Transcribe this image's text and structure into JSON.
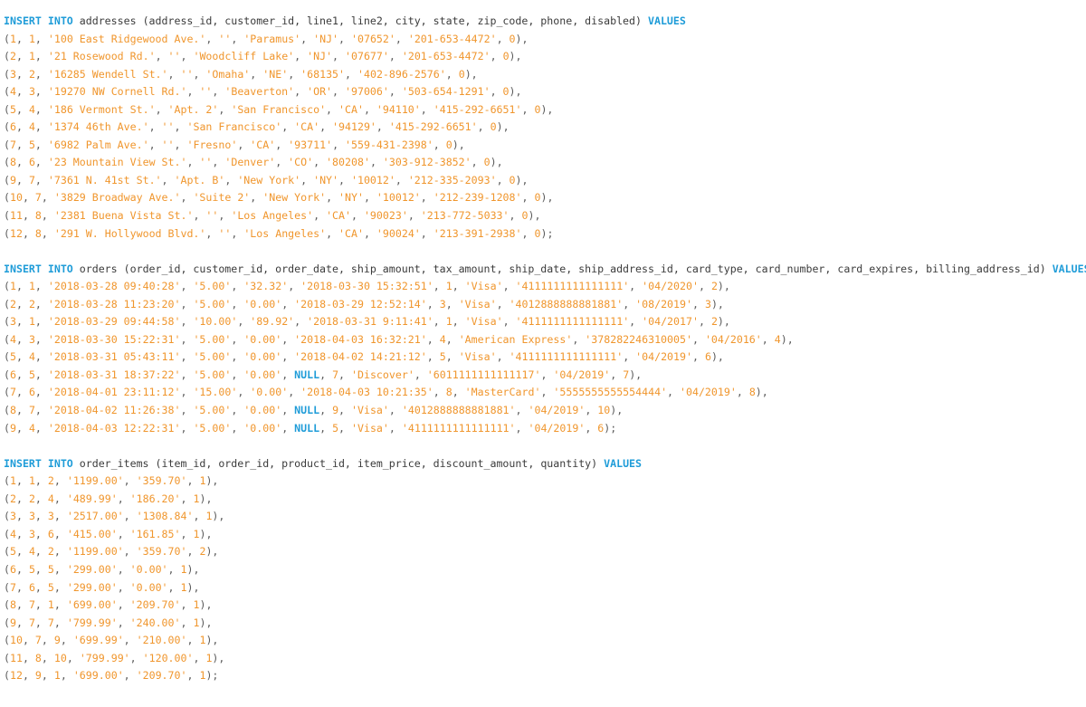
{
  "editor": {
    "language": "sql",
    "theme": {
      "background": "#ffffff",
      "keyword_color": "#1f9cd8",
      "identifier_color": "#3b3b3b",
      "string_color": "#f0962d",
      "number_color": "#f0962d",
      "punctuation_color": "#5b5b5b"
    }
  },
  "statements": [
    {
      "name": "insert-addresses",
      "keyword": "INSERT INTO",
      "table": "addresses",
      "columns": "(address_id, customer_id, line1, line2, city, state, zip_code, phone, disabled)",
      "values_keyword": "VALUES",
      "rows": [
        "(1, 1, '100 East Ridgewood Ave.', '', 'Paramus', 'NJ', '07652', '201-653-4472', 0),",
        "(2, 1, '21 Rosewood Rd.', '', 'Woodcliff Lake', 'NJ', '07677', '201-653-4472', 0),",
        "(3, 2, '16285 Wendell St.', '', 'Omaha', 'NE', '68135', '402-896-2576', 0),",
        "(4, 3, '19270 NW Cornell Rd.', '', 'Beaverton', 'OR', '97006', '503-654-1291', 0),",
        "(5, 4, '186 Vermont St.', 'Apt. 2', 'San Francisco', 'CA', '94110', '415-292-6651', 0),",
        "(6, 4, '1374 46th Ave.', '', 'San Francisco', 'CA', '94129', '415-292-6651', 0),",
        "(7, 5, '6982 Palm Ave.', '', 'Fresno', 'CA', '93711', '559-431-2398', 0),",
        "(8, 6, '23 Mountain View St.', '', 'Denver', 'CO', '80208', '303-912-3852', 0),",
        "(9, 7, '7361 N. 41st St.', 'Apt. B', 'New York', 'NY', '10012', '212-335-2093', 0),",
        "(10, 7, '3829 Broadway Ave.', 'Suite 2', 'New York', 'NY', '10012', '212-239-1208', 0),",
        "(11, 8, '2381 Buena Vista St.', '', 'Los Angeles', 'CA', '90023', '213-772-5033', 0),",
        "(12, 8, '291 W. Hollywood Blvd.', '', 'Los Angeles', 'CA', '90024', '213-391-2938', 0);"
      ]
    },
    {
      "name": "insert-orders",
      "keyword": "INSERT INTO",
      "table": "orders",
      "columns": "(order_id, customer_id, order_date, ship_amount, tax_amount, ship_date, ship_address_id, card_type, card_number, card_expires, billing_address_id)",
      "values_keyword": "VALUES",
      "rows": [
        "(1, 1, '2018-03-28 09:40:28', '5.00', '32.32', '2018-03-30 15:32:51', 1, 'Visa', '4111111111111111', '04/2020', 2),",
        "(2, 2, '2018-03-28 11:23:20', '5.00', '0.00', '2018-03-29 12:52:14', 3, 'Visa', '4012888888881881', '08/2019', 3),",
        "(3, 1, '2018-03-29 09:44:58', '10.00', '89.92', '2018-03-31 9:11:41', 1, 'Visa', '4111111111111111', '04/2017', 2),",
        "(4, 3, '2018-03-30 15:22:31', '5.00', '0.00', '2018-04-03 16:32:21', 4, 'American Express', '378282246310005', '04/2016', 4),",
        "(5, 4, '2018-03-31 05:43:11', '5.00', '0.00', '2018-04-02 14:21:12', 5, 'Visa', '4111111111111111', '04/2019', 6),",
        "(6, 5, '2018-03-31 18:37:22', '5.00', '0.00', NULL, 7, 'Discover', '6011111111111117', '04/2019', 7),",
        "(7, 6, '2018-04-01 23:11:12', '15.00', '0.00', '2018-04-03 10:21:35', 8, 'MasterCard', '5555555555554444', '04/2019', 8),",
        "(8, 7, '2018-04-02 11:26:38', '5.00', '0.00', NULL, 9, 'Visa', '4012888888881881', '04/2019', 10),",
        "(9, 4, '2018-04-03 12:22:31', '5.00', '0.00', NULL, 5, 'Visa', '4111111111111111', '04/2019', 6);"
      ]
    },
    {
      "name": "insert-order-items",
      "keyword": "INSERT INTO",
      "table": "order_items",
      "columns": "(item_id, order_id, product_id, item_price, discount_amount, quantity)",
      "values_keyword": "VALUES",
      "rows": [
        "(1, 1, 2, '1199.00', '359.70', 1),",
        "(2, 2, 4, '489.99', '186.20', 1),",
        "(3, 3, 3, '2517.00', '1308.84', 1),",
        "(4, 3, 6, '415.00', '161.85', 1),",
        "(5, 4, 2, '1199.00', '359.70', 2),",
        "(6, 5, 5, '299.00', '0.00', 1),",
        "(7, 6, 5, '299.00', '0.00', 1),",
        "(8, 7, 1, '699.00', '209.70', 1),",
        "(9, 7, 7, '799.99', '240.00', 1),",
        "(10, 7, 9, '699.99', '210.00', 1),",
        "(11, 8, 10, '799.99', '120.00', 1),",
        "(12, 9, 1, '699.00', '209.70', 1);"
      ]
    }
  ]
}
